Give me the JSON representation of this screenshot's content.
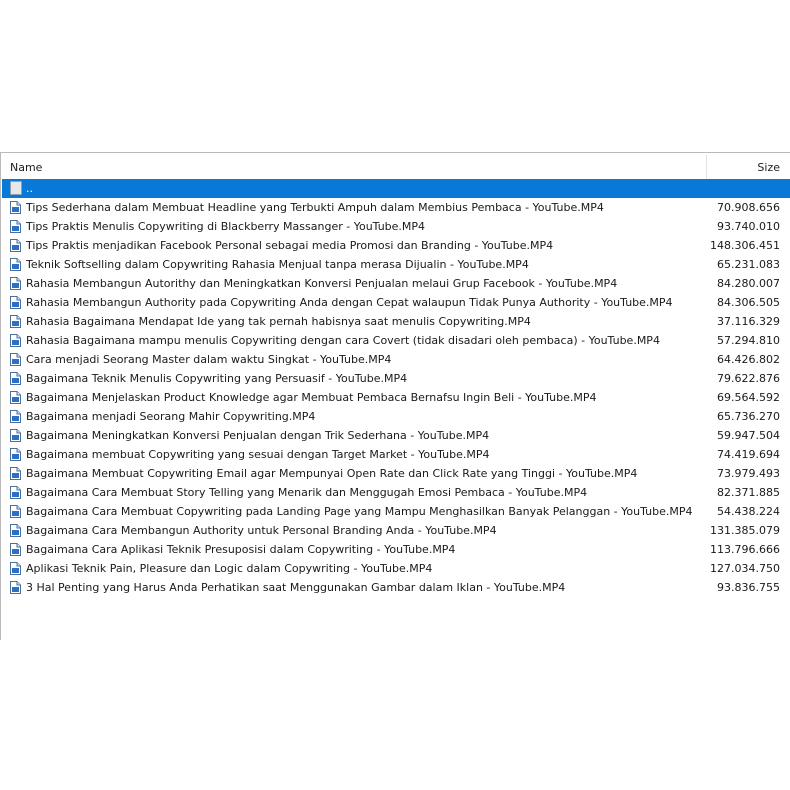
{
  "columns": {
    "name": "Name",
    "size": "Size"
  },
  "parent_row": {
    "label": ".."
  },
  "files": [
    {
      "name": "Tips Sederhana dalam Membuat Headline yang Terbukti Ampuh dalam Membius Pembaca - YouTube.MP4",
      "size": "70.908.656"
    },
    {
      "name": "Tips Praktis Menulis Copywriting di Blackberry Massanger - YouTube.MP4",
      "size": "93.740.010"
    },
    {
      "name": "Tips Praktis menjadikan Facebook Personal sebagai media Promosi dan Branding - YouTube.MP4",
      "size": "148.306.451"
    },
    {
      "name": "Teknik Softselling dalam Copywriting Rahasia Menjual tanpa merasa Dijualin - YouTube.MP4",
      "size": "65.231.083"
    },
    {
      "name": "Rahasia Membangun Autorithy dan Meningkatkan Konversi Penjualan melaui Grup Facebook - YouTube.MP4",
      "size": "84.280.007"
    },
    {
      "name": "Rahasia Membangun Authority pada Copywriting Anda dengan Cepat walaupun Tidak Punya Authority - YouTube.MP4",
      "size": "84.306.505"
    },
    {
      "name": "Rahasia Bagaimana Mendapat Ide yang tak pernah habisnya saat menulis Copywriting.MP4",
      "size": "37.116.329"
    },
    {
      "name": "Rahasia Bagaimana mampu menulis Copywriting dengan cara Covert (tidak disadari oleh pembaca) - YouTube.MP4",
      "size": "57.294.810"
    },
    {
      "name": "Cara menjadi Seorang Master dalam waktu Singkat - YouTube.MP4",
      "size": "64.426.802"
    },
    {
      "name": "Bagaimana Teknik Menulis Copywriting yang Persuasif - YouTube.MP4",
      "size": "79.622.876"
    },
    {
      "name": "Bagaimana Menjelaskan Product Knowledge agar Membuat Pembaca Bernafsu Ingin Beli - YouTube.MP4",
      "size": "69.564.592"
    },
    {
      "name": "Bagaimana menjadi Seorang Mahir Copywriting.MP4",
      "size": "65.736.270"
    },
    {
      "name": "Bagaimana Meningkatkan Konversi Penjualan dengan Trik Sederhana - YouTube.MP4",
      "size": "59.947.504"
    },
    {
      "name": "Bagaimana membuat Copywriting yang sesuai dengan Target Market - YouTube.MP4",
      "size": "74.419.694"
    },
    {
      "name": "Bagaimana Membuat Copywriting Email agar Mempunyai Open Rate dan Click Rate yang Tinggi - YouTube.MP4",
      "size": "73.979.493"
    },
    {
      "name": "Bagaimana Cara Membuat Story Telling yang Menarik dan Menggugah Emosi Pembaca - YouTube.MP4",
      "size": "82.371.885"
    },
    {
      "name": "Bagaimana Cara Membuat Copywriting pada Landing Page yang Mampu Menghasilkan Banyak Pelanggan - YouTube.MP4",
      "size": "54.438.224"
    },
    {
      "name": "Bagaimana Cara Membangun Authority untuk Personal Branding Anda - YouTube.MP4",
      "size": "131.385.079"
    },
    {
      "name": "Bagaimana Cara Aplikasi Teknik Presuposisi dalam Copywriting - YouTube.MP4",
      "size": "113.796.666"
    },
    {
      "name": "Aplikasi Teknik Pain, Pleasure dan Logic dalam Copywriting - YouTube.MP4",
      "size": "127.034.750"
    },
    {
      "name": "3 Hal Penting yang Harus Anda Perhatikan saat Menggunakan Gambar dalam Iklan - YouTube.MP4",
      "size": "93.836.755"
    }
  ],
  "icons": {
    "file": "document-icon",
    "parent": "folder-up-icon",
    "sort": "sort-descending-icon"
  },
  "colors": {
    "selection": "#0a78d7",
    "header_text": "#202020",
    "row_text": "#1a1a1a"
  }
}
